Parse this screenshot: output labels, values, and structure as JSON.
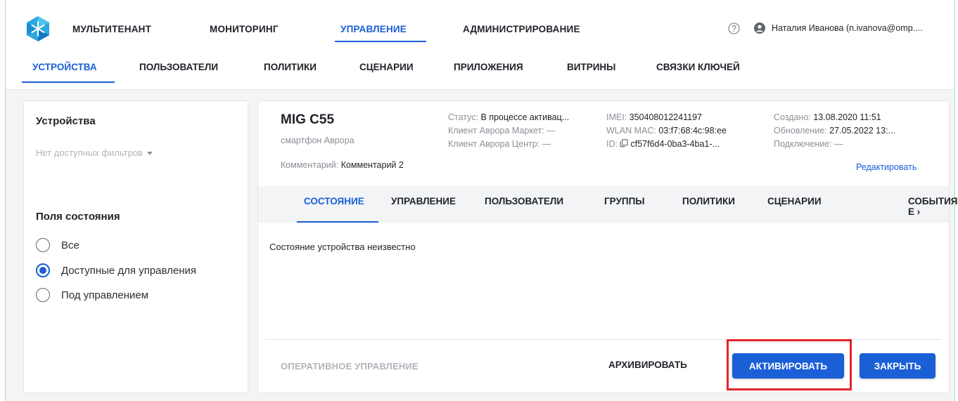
{
  "topnav": {
    "items": [
      "МУЛЬТИТЕНАНТ",
      "МОНИТОРИНГ",
      "УПРАВЛЕНИЕ",
      "АДМИНИСТРИРОВАНИЕ"
    ],
    "active": "УПРАВЛЕНИЕ",
    "user": "Наталия Иванова (n.ivanova@omp...."
  },
  "subnav": {
    "items": [
      "УСТРОЙСТВА",
      "ПОЛЬЗОВАТЕЛИ",
      "ПОЛИТИКИ",
      "СЦЕНАРИИ",
      "ПРИЛОЖЕНИЯ",
      "ВИТРИНЫ",
      "СВЯЗКИ КЛЮЧЕЙ"
    ],
    "active": "УСТРОЙСТВА"
  },
  "left_panel": {
    "title": "Устройства",
    "filter_placeholder": "Нет доступных фильтров",
    "status_title": "Поля состояния",
    "options": [
      "Все",
      "Доступные для управления",
      "Под управлением"
    ],
    "selected": "Доступные для управления"
  },
  "device": {
    "name": "MIG C55",
    "type": "смартфон Аврора",
    "comment_label": "Комментарий:",
    "comment_value": "Комментарий 2",
    "status_label": "Статус:",
    "status_value": "В процессе активац...",
    "market_label": "Клиент Аврора Маркет:",
    "market_value": "—",
    "center_label": "Клиент Аврора Центр:",
    "center_value": "—",
    "imei_label": "IMEI:",
    "imei_value": "350408012241197",
    "wlan_label": "WLAN MAC:",
    "wlan_value": "03:f7:68:4c:98:ee",
    "id_label": "ID:",
    "id_value": "cf57f6d4-0ba3-4ba1-...",
    "created_label": "Создано:",
    "created_value": "13.08.2020 11:51",
    "updated_label": "Обновление:",
    "updated_value": "27.05.2022 13:...",
    "connection_label": "Подключение:",
    "connection_value": "—",
    "edit_label": "Редактировать"
  },
  "tabs": {
    "items": [
      "СОСТОЯНИЕ",
      "УПРАВЛЕНИЕ",
      "ПОЛЬЗОВАТЕЛИ",
      "ГРУППЫ",
      "ПОЛИТИКИ",
      "СЦЕНАРИИ"
    ],
    "active": "СОСТОЯНИЕ",
    "more_label": "СОБЫТИЯ Е",
    "more_chevron": "›"
  },
  "state_text": "Состояние устройства неизвестно",
  "footer": {
    "op_mgmt": "ОПЕРАТИВНОЕ УПРАВЛЕНИЕ",
    "archive": "АРХИВИРОВАТЬ",
    "activate": "АКТИВИРОВАТЬ",
    "close": "ЗАКРЫТЬ"
  },
  "colors": {
    "accent": "#1a5fd6",
    "highlight": "#e2242a",
    "panel_bg": "#f3f4f6"
  }
}
